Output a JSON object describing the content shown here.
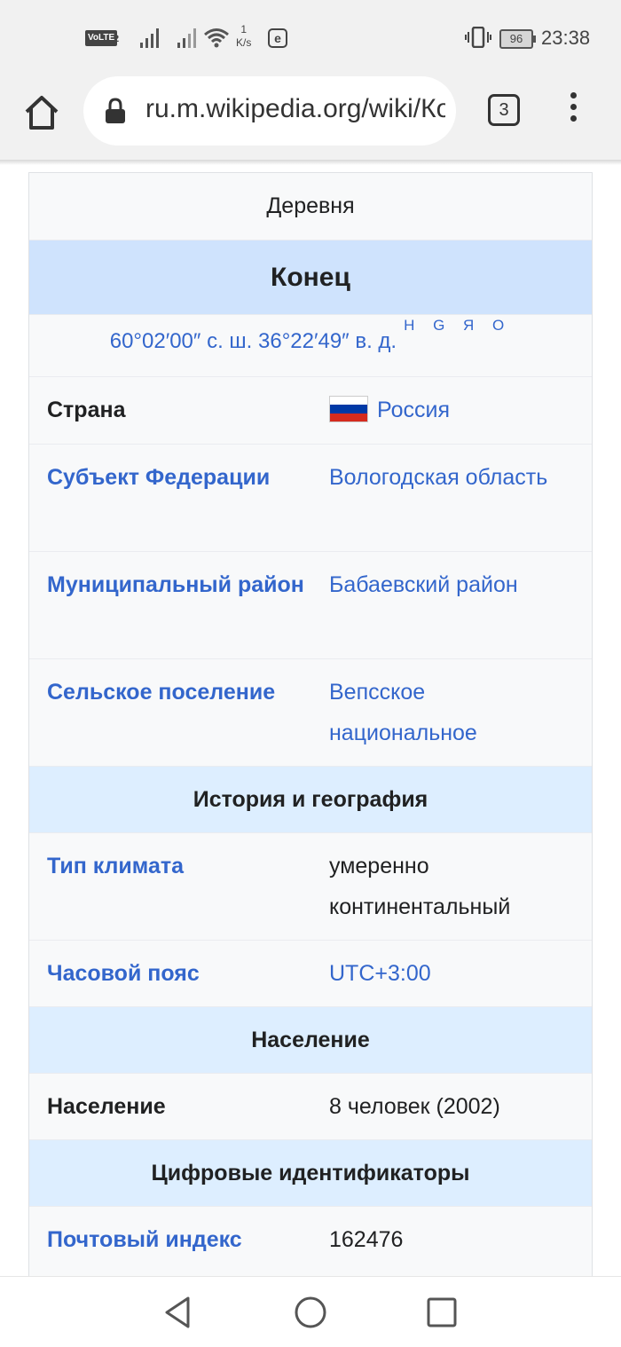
{
  "status_bar": {
    "volte": "VoLTE",
    "sim": "2",
    "net_speed_value": "1",
    "net_speed_unit": "K/s",
    "e_badge": "e",
    "battery": "96",
    "time": "23:38"
  },
  "browser": {
    "url": "ru.m.wikipedia.org/wiki/Конец",
    "tab_count": "3"
  },
  "infobox": {
    "type": "Деревня",
    "title": "Конец",
    "coordinates": "60°02′00″ с. ш. 36°22′49″ в. д.",
    "coordinate_links": "H G Я O",
    "country_label": "Страна",
    "country_value": "Россия",
    "subject_label": "Субъект Федерации",
    "subject_value": "Вологодская область",
    "municipal_label": "Муниципальный район",
    "municipal_value": "Бабаевский район",
    "settlement_label": "Сельское поселение",
    "settlement_value": "Вепсское национальное",
    "section_history": "История и география",
    "climate_label": "Тип климата",
    "climate_value": "умеренно континентальный",
    "timezone_label": "Часовой пояс",
    "timezone_value": "UTC+3:00",
    "section_population": "Население",
    "population_label": "Население",
    "population_value": "8 человек (2002)",
    "section_ids": "Цифровые идентификаторы",
    "postcode_label": "Почтовый индекс",
    "postcode_value": "162476"
  },
  "colors": {
    "link": "#3366cc",
    "title_bg": "#cfe3fd",
    "section_bg": "#ddeeff",
    "flag": [
      "#ffffff",
      "#0039a6",
      "#d52b1e"
    ]
  },
  "icons": {
    "home": "home-icon",
    "lock": "lock-icon",
    "tabs": "tab-switcher-icon",
    "menu": "more-vert-icon",
    "back": "triangle-back-icon",
    "home_nav": "circle-home-icon",
    "recents": "square-recents-icon"
  }
}
